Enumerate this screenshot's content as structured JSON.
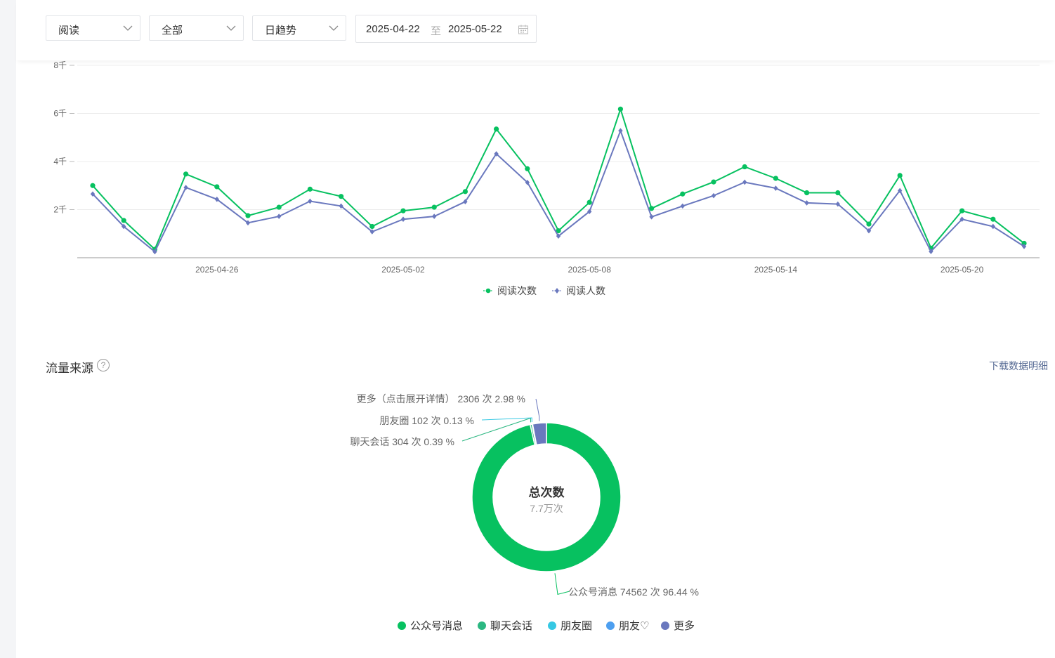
{
  "filters": {
    "metric": "阅读",
    "scope": "全部",
    "granularity": "日趋势",
    "date_start": "2025-04-22",
    "date_sep": "至",
    "date_end": "2025-05-22"
  },
  "chart_data": [
    {
      "type": "line",
      "y_ticks": [
        "8千",
        "6千",
        "4千",
        "2千"
      ],
      "ylim": [
        0,
        8000
      ],
      "x_tick_labels": [
        "2025-04-26",
        "2025-05-02",
        "2025-05-08",
        "2025-05-14",
        "2025-05-20"
      ],
      "x_dates": [
        "2025-04-22",
        "2025-04-23",
        "2025-04-24",
        "2025-04-25",
        "2025-04-26",
        "2025-04-27",
        "2025-04-28",
        "2025-04-29",
        "2025-04-30",
        "2025-05-01",
        "2025-05-02",
        "2025-05-03",
        "2025-05-04",
        "2025-05-05",
        "2025-05-06",
        "2025-05-07",
        "2025-05-08",
        "2025-05-09",
        "2025-05-10",
        "2025-05-11",
        "2025-05-12",
        "2025-05-13",
        "2025-05-14",
        "2025-05-15",
        "2025-05-16",
        "2025-05-17",
        "2025-05-18",
        "2025-05-19",
        "2025-05-20",
        "2025-05-21",
        "2025-05-22"
      ],
      "series": [
        {
          "name": "阅读次数",
          "color": "#07c160",
          "marker": "circle",
          "values": [
            3000,
            1550,
            350,
            3480,
            2950,
            1750,
            2100,
            2850,
            2550,
            1300,
            1950,
            2100,
            2750,
            5350,
            3700,
            1120,
            2300,
            6180,
            2050,
            2650,
            3150,
            3780,
            3300,
            2700,
            2700,
            1400,
            3420,
            400,
            1950,
            1600,
            600
          ]
        },
        {
          "name": "阅读人数",
          "color": "#6a78be",
          "marker": "diamond",
          "values": [
            2650,
            1300,
            250,
            2920,
            2430,
            1450,
            1720,
            2350,
            2150,
            1080,
            1600,
            1720,
            2330,
            4320,
            3130,
            900,
            1920,
            5280,
            1700,
            2150,
            2580,
            3140,
            2890,
            2280,
            2230,
            1120,
            2790,
            260,
            1600,
            1300,
            470
          ]
        }
      ],
      "grid": true,
      "legend": "bottom-center"
    },
    {
      "type": "pie",
      "title": "流量来源",
      "center_label": "总次数",
      "center_value": "7.7万次",
      "slices": [
        {
          "name": "公众号消息",
          "value": 74562,
          "percent": 96.44,
          "color": "#07c160",
          "label": "公众号消息 74562 次 96.44 %"
        },
        {
          "name": "聊天会话",
          "value": 304,
          "percent": 0.39,
          "color": "#2bb781",
          "label": "聊天会话 304 次 0.39 %"
        },
        {
          "name": "朋友圈",
          "value": 102,
          "percent": 0.13,
          "color": "#36c8e3",
          "label": "朋友圈 102 次 0.13 %"
        },
        {
          "name": "更多",
          "value": 2306,
          "percent": 2.98,
          "color": "#6a78be",
          "label": "更多（点击展开详情） 2306 次 2.98 %"
        }
      ],
      "legend": [
        {
          "name": "公众号消息",
          "color": "#07c160"
        },
        {
          "name": "聊天会话",
          "color": "#2bb781"
        },
        {
          "name": "朋友圈",
          "color": "#36c8e3"
        },
        {
          "name": "朋友♡",
          "color": "#4d9ff0"
        },
        {
          "name": "更多",
          "color": "#6a78be"
        }
      ]
    }
  ],
  "traffic": {
    "title": "流量来源",
    "help": "?",
    "download": "下载数据明细"
  }
}
